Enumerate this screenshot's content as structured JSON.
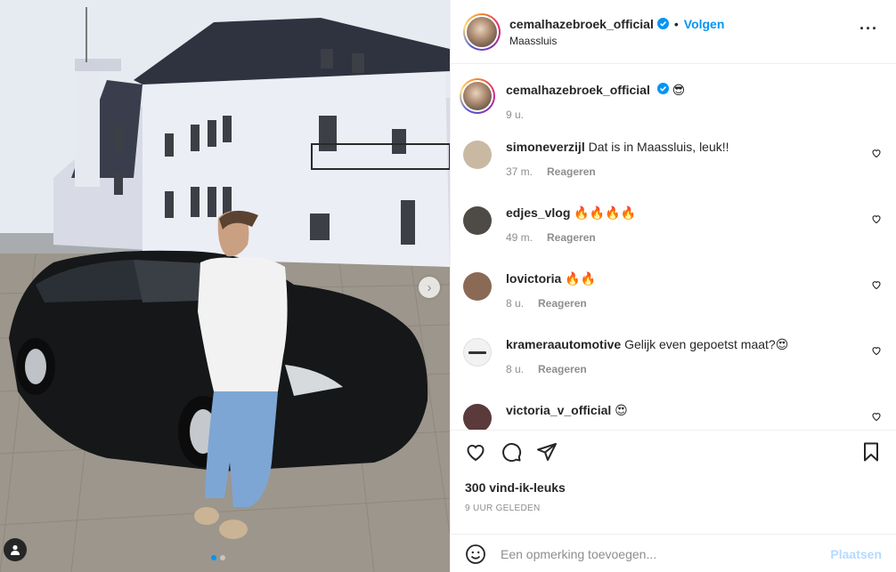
{
  "header": {
    "username": "cemalhazebroek_official",
    "separator": "•",
    "follow_label": "Volgen",
    "location": "Maassluis",
    "more_label": "···"
  },
  "caption": {
    "username": "cemalhazebroek_official",
    "text": "😎",
    "time": "9 u."
  },
  "comments": [
    {
      "username": "simoneverzijl",
      "text": "Dat is in Maassluis, leuk!!",
      "time": "37 m.",
      "reply": "Reageren",
      "avatar_color": "#c9b9a3"
    },
    {
      "username": "edjes_vlog",
      "text": "🔥🔥🔥🔥",
      "time": "49 m.",
      "reply": "Reageren",
      "avatar_color": "#4e4a45"
    },
    {
      "username": "lovictoria",
      "text": "🔥🔥",
      "time": "8 u.",
      "reply": "Reageren",
      "avatar_color": "#8a6a55"
    },
    {
      "username": "krameraautomotive",
      "text": "Gelijk even gepoetst maat?😍",
      "time": "8 u.",
      "reply": "Reageren",
      "avatar_color": "#f2f2f2"
    },
    {
      "username": "victoria_v_official",
      "text": "😍",
      "time": "",
      "reply": "",
      "avatar_color": "#5a3a3a"
    }
  ],
  "actions": {
    "likes": "300 vind-ik-leuks",
    "time": "9 UUR GELEDEN"
  },
  "add_comment": {
    "placeholder": "Een opmerking toevoegen...",
    "post_label": "Plaatsen"
  },
  "carousel": {
    "count": 2,
    "active": 1
  },
  "colors": {
    "link": "#0095f6",
    "muted": "#8e8e8e",
    "text": "#262626",
    "post_disabled": "#b3dbff"
  }
}
